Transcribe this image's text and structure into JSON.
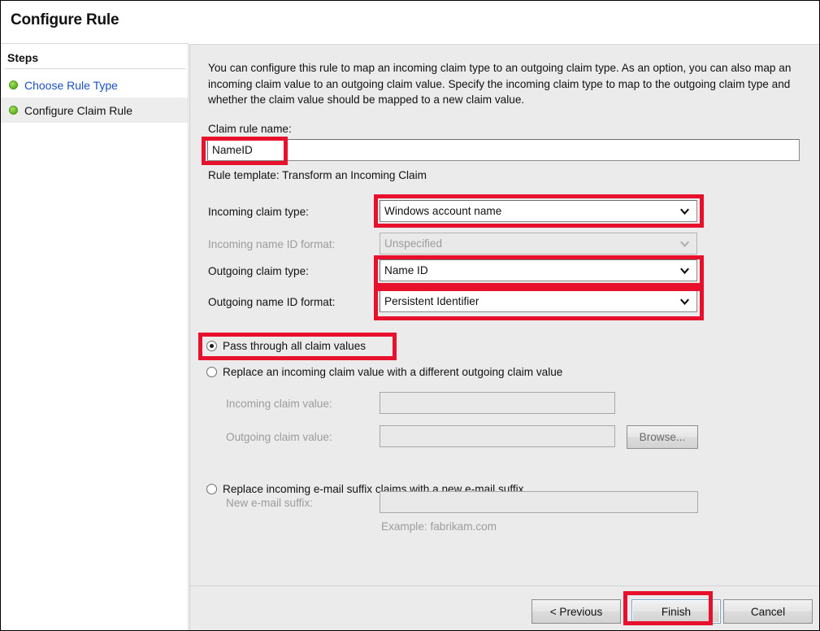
{
  "window": {
    "title": "Configure Rule"
  },
  "sidebar": {
    "heading": "Steps",
    "items": [
      {
        "label": "Choose Rule Type",
        "state": "link"
      },
      {
        "label": "Configure Claim Rule",
        "state": "current"
      }
    ]
  },
  "main": {
    "intro": "You can configure this rule to map an incoming claim type to an outgoing claim type. As an option, you can also map an incoming claim value to an outgoing claim value. Specify the incoming claim type to map to the outgoing claim type and whether the claim value should be mapped to a new claim value.",
    "claim_rule_name_label": "Claim rule name:",
    "claim_rule_name_value": "NameID",
    "rule_template_text": "Rule template: Transform an Incoming Claim",
    "fields": [
      {
        "label": "Incoming claim type:",
        "value": "Windows account name",
        "enabled": true,
        "highlighted": true
      },
      {
        "label": "Incoming name ID format:",
        "value": "Unspecified",
        "enabled": false,
        "highlighted": false
      },
      {
        "label": "Outgoing claim type:",
        "value": "Name ID",
        "enabled": true,
        "highlighted": true
      },
      {
        "label": "Outgoing name ID format:",
        "value": "Persistent Identifier",
        "enabled": true,
        "highlighted": true
      }
    ],
    "options": [
      {
        "label": "Pass through all claim values",
        "selected": true,
        "highlighted": true
      },
      {
        "label": "Replace an incoming claim value with a different outgoing claim value",
        "selected": false,
        "highlighted": false
      },
      {
        "label": "Replace incoming e-mail suffix claims with a new e-mail suffix",
        "selected": false,
        "highlighted": false
      }
    ],
    "replace_fields": {
      "incoming_claim_value_label": "Incoming claim value:",
      "incoming_claim_value": "",
      "outgoing_claim_value_label": "Outgoing claim value:",
      "outgoing_claim_value": "",
      "browse_label": "Browse..."
    },
    "email_suffix_fields": {
      "new_email_suffix_label": "New e-mail suffix:",
      "new_email_suffix": "",
      "example_note": "Example: fabrikam.com"
    }
  },
  "footer": {
    "previous_label": "< Previous",
    "finish_label": "Finish",
    "cancel_label": "Cancel",
    "finish_highlighted": true
  },
  "colors": {
    "annotation": "#e8112d",
    "link": "#1a4fc4",
    "step_dot": "#6cc02a",
    "panel_bg": "#ebebeb",
    "disabled_text": "#9c9c9c"
  }
}
